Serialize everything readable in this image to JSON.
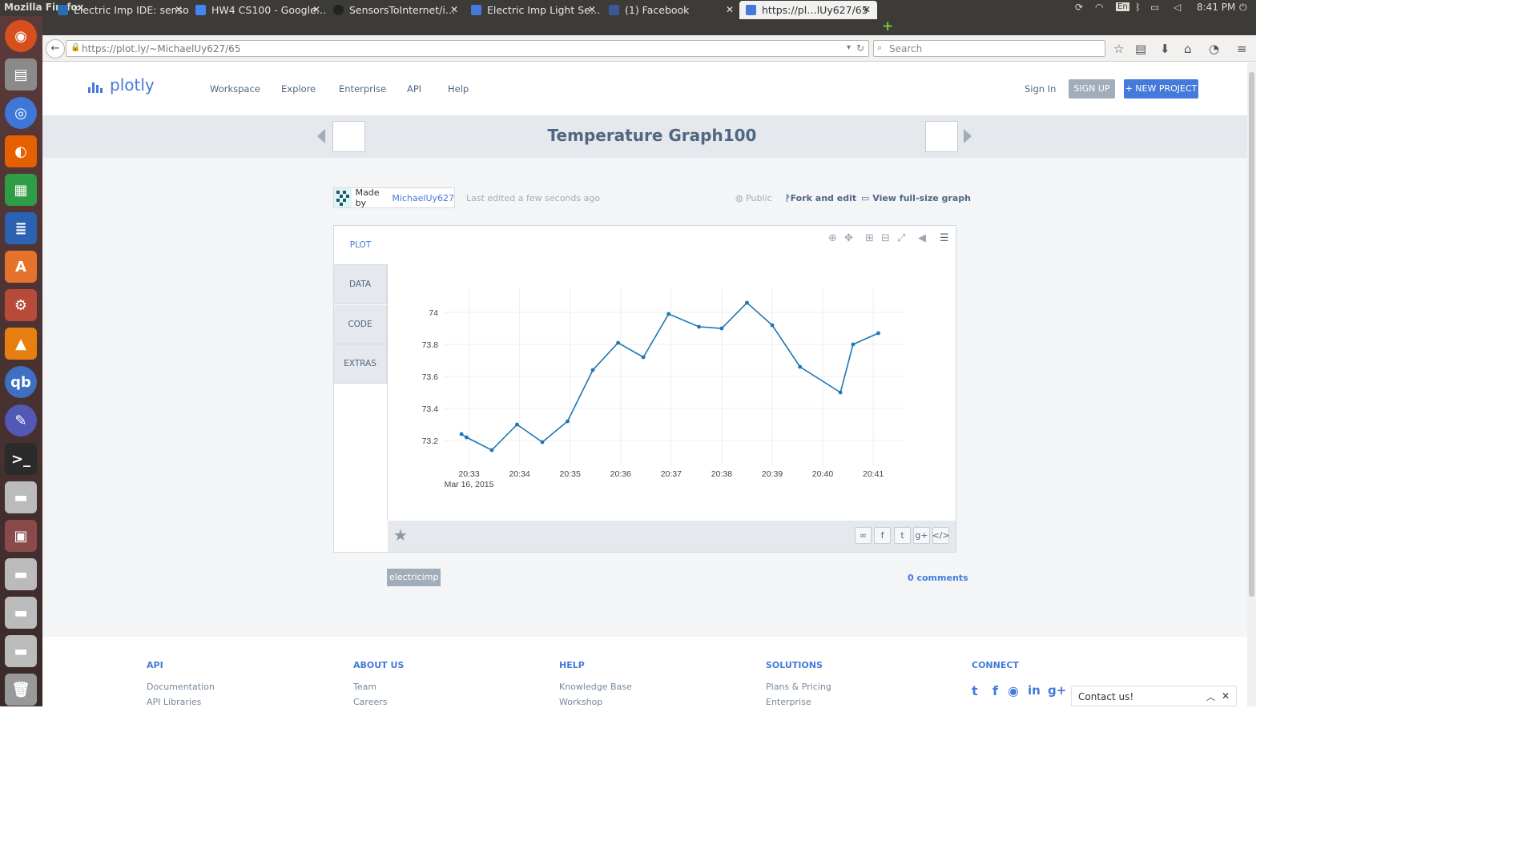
{
  "system": {
    "window_title": "Mozilla Firefox",
    "time": "8:41 PM",
    "keyboard": "En"
  },
  "tabs": [
    {
      "label": "Electric Imp IDE: sensor…",
      "color": "#2a6db0"
    },
    {
      "label": "HW4 CS100 - Google…",
      "color": "#4285f4"
    },
    {
      "label": "SensorsToInternet/i…",
      "color": "#222222"
    },
    {
      "label": "Electric Imp Light Se…",
      "color": "#447adb"
    },
    {
      "label": "(1) Facebook",
      "color": "#3b5998"
    },
    {
      "label": "https://pl…lUy627/65",
      "color": "#447adb"
    }
  ],
  "nav": {
    "url_host": "https://plot.ly",
    "url_path": "/~MichaelUy627/65",
    "search_placeholder": "Search"
  },
  "site": {
    "logo": "plotly",
    "menu": [
      "Workspace",
      "Explore",
      "Enterprise",
      "API",
      "Help"
    ],
    "sign_in": "Sign In",
    "sign_up": "SIGN UP",
    "new_project": "+ NEW PROJECT",
    "accent": "#447adb"
  },
  "graph_page": {
    "title": "Temperature Graph100",
    "made_by_prefix": "Made by",
    "author": "MichaelUy627",
    "last_edited": "Last edited a few seconds ago",
    "public": "Public",
    "fork": "Fork and edit",
    "full_size": "View full-size graph",
    "side_tabs": [
      "PLOT",
      "DATA",
      "CODE",
      "EXTRAS"
    ],
    "tag": "electricimp",
    "comments": "0 comments"
  },
  "chart_data": {
    "type": "line",
    "x_ticks": [
      "20:33",
      "20:34",
      "20:35",
      "20:36",
      "20:37",
      "20:38",
      "20:39",
      "20:40",
      "20:41"
    ],
    "x_date_label": "Mar 16, 2015",
    "y_ticks": [
      73.2,
      73.4,
      73.6,
      73.8,
      74
    ],
    "ylim": [
      73.05,
      74.15
    ],
    "xlim_minutes": [
      32.5,
      41.6
    ],
    "grid": true,
    "color": "#1f77b4",
    "series": [
      {
        "x": [
          32.85,
          32.95,
          33.45,
          33.95,
          34.45,
          34.95,
          35.45,
          35.95,
          36.45,
          36.95,
          37.55,
          38.0,
          38.5,
          39.0,
          39.55,
          40.35,
          40.6,
          41.1
        ],
        "y": [
          73.24,
          73.22,
          73.14,
          73.3,
          73.19,
          73.32,
          73.64,
          73.81,
          73.72,
          73.99,
          73.91,
          73.9,
          74.06,
          73.92,
          73.66,
          73.5,
          73.8,
          73.87
        ]
      }
    ]
  },
  "footer": {
    "columns": [
      {
        "head": "API",
        "links": [
          "Documentation",
          "API Libraries"
        ]
      },
      {
        "head": "ABOUT US",
        "links": [
          "Team",
          "Careers"
        ]
      },
      {
        "head": "HELP",
        "links": [
          "Knowledge Base",
          "Workshop"
        ]
      },
      {
        "head": "SOLUTIONS",
        "links": [
          "Plans & Pricing",
          "Enterprise"
        ]
      },
      {
        "head": "CONNECT",
        "links": []
      }
    ],
    "contact": "Contact us!"
  }
}
